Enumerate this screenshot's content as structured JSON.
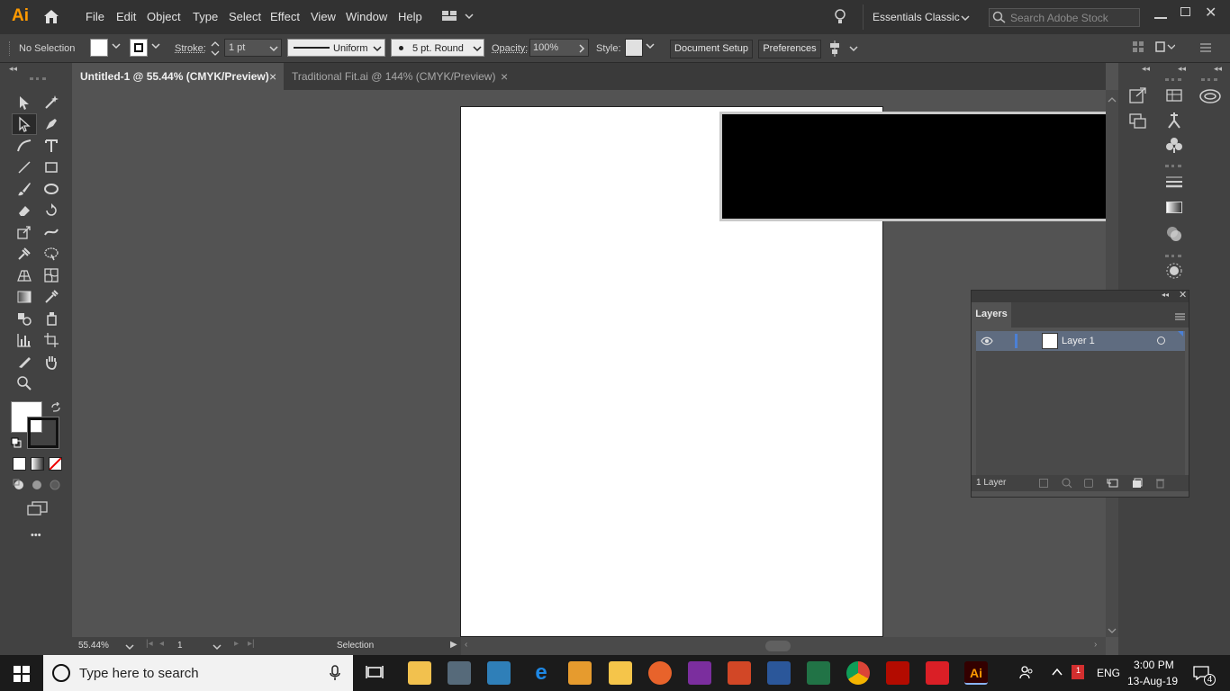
{
  "app": {
    "logo": "Ai",
    "workspace": "Essentials Classic",
    "search_placeholder": "Search Adobe Stock"
  },
  "menu": {
    "items": [
      "File",
      "Edit",
      "Object",
      "Type",
      "Select",
      "Effect",
      "View",
      "Window",
      "Help"
    ]
  },
  "control": {
    "selection": "No Selection",
    "stroke_label": "Stroke:",
    "stroke_value": "1 pt",
    "profile": "Uniform",
    "brush": "5 pt. Round",
    "opacity_label": "Opacity:",
    "opacity_value": "100%",
    "style_label": "Style:",
    "document_setup": "Document Setup",
    "preferences": "Preferences"
  },
  "tabs": [
    {
      "label": "Untitled-1 @ 55.44% (CMYK/Preview)",
      "close": "×"
    },
    {
      "label": "Traditional Fit.ai @ 144% (CMYK/Preview)",
      "close": "×"
    }
  ],
  "tools": {
    "more": "•••"
  },
  "layers": {
    "title": "Layers",
    "layer_name": "Layer 1",
    "count": "1 Layer"
  },
  "status": {
    "zoom": "55.44%",
    "page": "1",
    "tool": "Selection"
  },
  "taskbar": {
    "search_placeholder": "Type here to search",
    "lang": "ENG",
    "time": "3:00 PM",
    "date": "13-Aug-19",
    "notif_count": "4",
    "badge": "1"
  },
  "colors": {
    "accent": "#4b80d6",
    "chrome": "#323232",
    "panel": "#424242",
    "canvas": "#535353"
  }
}
